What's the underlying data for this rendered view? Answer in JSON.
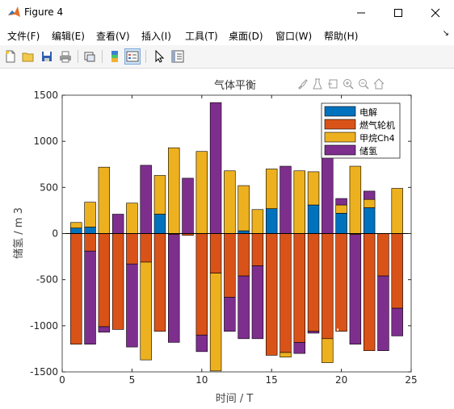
{
  "window": {
    "title": "Figure 4",
    "icon": "matlab-icon",
    "controls": [
      "minimize-icon",
      "maximize-icon",
      "close-icon"
    ]
  },
  "menu": [
    "文件(F)",
    "编辑(E)",
    "查看(V)",
    "插入(I)",
    "工具(T)",
    "桌面(D)",
    "窗口(W)",
    "帮助(H)"
  ],
  "toolbar": [
    "new-figure-icon",
    "open-icon",
    "save-icon",
    "print-icon",
    "link-plot-icon",
    "colorbar-icon",
    "legend-icon",
    "pointer-icon",
    "property-inspector-icon"
  ],
  "axes_toolbar": [
    "brush-icon",
    "data-tips-icon",
    "restore-view-icon",
    "zoom-in-icon",
    "zoom-out-icon",
    "home-icon"
  ],
  "colors": {
    "电解": "#0072BD",
    "燃气轮机": "#D95319",
    "甲烷Ch4": "#EDB120",
    "储氢": "#7E2F8E"
  },
  "chart_data": {
    "type": "bar",
    "stacked": true,
    "title": "气体平衡",
    "xlabel": "时间 / T",
    "ylabel": "储氢 / m 3",
    "xlim": [
      0,
      25
    ],
    "ylim": [
      -1500,
      1500
    ],
    "xticks": [
      0,
      5,
      10,
      15,
      20,
      25
    ],
    "yticks": [
      -1500,
      -1000,
      -500,
      0,
      500,
      1000,
      1500
    ],
    "grid": false,
    "legend_position": "top-right",
    "x": [
      1,
      2,
      3,
      4,
      5,
      6,
      7,
      8,
      9,
      10,
      11,
      12,
      13,
      14,
      15,
      16,
      17,
      18,
      19,
      20,
      21,
      22,
      23,
      24
    ],
    "series": [
      {
        "name": "电解",
        "values": [
          60,
          70,
          0,
          0,
          0,
          0,
          210,
          0,
          0,
          0,
          0,
          0,
          30,
          0,
          270,
          0,
          0,
          310,
          0,
          220,
          0,
          280,
          0,
          0
        ]
      },
      {
        "name": "燃气轮机",
        "values": [
          -1200,
          -190,
          -1010,
          -1040,
          -330,
          -310,
          -1060,
          -10,
          -20,
          -1100,
          -430,
          -690,
          -460,
          -350,
          -1320,
          -1290,
          -1180,
          -1060,
          -1140,
          -1060,
          -10,
          -1270,
          -460,
          -810
        ]
      },
      {
        "name": "甲烷Ch4",
        "values": [
          60,
          270,
          720,
          0,
          330,
          -1060,
          420,
          930,
          0,
          890,
          -1060,
          680,
          490,
          260,
          430,
          -50,
          680,
          360,
          -260,
          90,
          730,
          90,
          0,
          490
        ]
      },
      {
        "name": "储氢",
        "values": [
          0,
          -1010,
          -60,
          210,
          -900,
          740,
          0,
          -1170,
          600,
          -180,
          1420,
          -370,
          -680,
          -790,
          0,
          730,
          -120,
          -20,
          1220,
          70,
          -1190,
          90,
          -810,
          -300
        ]
      }
    ],
    "annotations": [
      "·"
    ]
  }
}
